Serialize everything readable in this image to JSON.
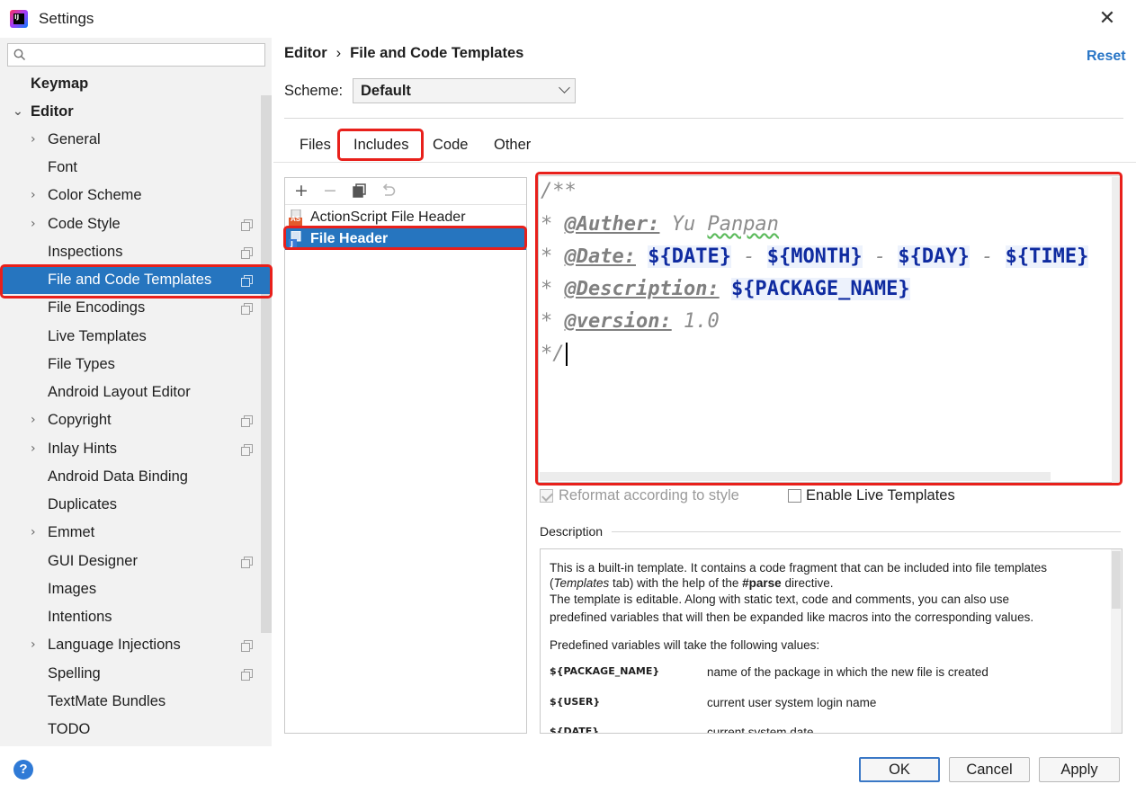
{
  "window": {
    "title": "Settings"
  },
  "sidebar": {
    "search_placeholder": "",
    "items": [
      {
        "label": "Keymap"
      },
      {
        "label": "Editor"
      },
      {
        "label": "General"
      },
      {
        "label": "Font"
      },
      {
        "label": "Color Scheme"
      },
      {
        "label": "Code Style"
      },
      {
        "label": "Inspections"
      },
      {
        "label": "File and Code Templates"
      },
      {
        "label": "File Encodings"
      },
      {
        "label": "Live Templates"
      },
      {
        "label": "File Types"
      },
      {
        "label": "Android Layout Editor"
      },
      {
        "label": "Copyright"
      },
      {
        "label": "Inlay Hints"
      },
      {
        "label": "Android Data Binding"
      },
      {
        "label": "Duplicates"
      },
      {
        "label": "Emmet"
      },
      {
        "label": "GUI Designer"
      },
      {
        "label": "Images"
      },
      {
        "label": "Intentions"
      },
      {
        "label": "Language Injections"
      },
      {
        "label": "Spelling"
      },
      {
        "label": "TextMate Bundles"
      },
      {
        "label": "TODO"
      }
    ]
  },
  "header": {
    "breadcrumb_parent": "Editor",
    "breadcrumb_sep": "›",
    "breadcrumb_current": "File and Code Templates",
    "reset_label": "Reset",
    "scheme_label": "Scheme:",
    "scheme_value": "Default"
  },
  "tabs": [
    {
      "label": "Files"
    },
    {
      "label": "Includes"
    },
    {
      "label": "Code"
    },
    {
      "label": "Other"
    }
  ],
  "templates": {
    "items": [
      {
        "name": "ActionScript File Header",
        "icon_text": "AS"
      },
      {
        "name": "File Header"
      }
    ],
    "selected": "File Header"
  },
  "editor": {
    "line1": "/**",
    "line2_star": "* ",
    "line2_tag": "@Auther:",
    "line2_value_a": " Yu ",
    "line2_value_b": "Panpan",
    "line3_star": "* ",
    "line3_tag": "@Date:",
    "line3_v1": "${DATE}",
    "line3_s1": " - ",
    "line3_v2": "${MONTH}",
    "line3_s2": " - ",
    "line3_v3": "${DAY}",
    "line3_s3": " - ",
    "line3_v4": "${TIME}",
    "line4_star": "* ",
    "line4_tag": "@Description:",
    "line4_v": "${PACKAGE_NAME}",
    "line5_star": "* ",
    "line5_tag": "@version:",
    "line5_value": " 1.0",
    "line6": "*/"
  },
  "options": {
    "reformat_label": "Reformat according to style",
    "reformat_checked": true,
    "live_templates_label": "Enable Live Templates",
    "live_templates_checked": false
  },
  "description": {
    "title": "Description",
    "p1_a": "This is a built-in template. It contains a code fragment that can be included into file templates",
    "p1_b_italic": "Templates",
    "p1_b_rest1": " tab) with the help of the ",
    "p1_b_bold": "#parse",
    "p1_b_rest2": " directive.",
    "p2_a": "The template is editable. Along with static text, code and comments, you can also use",
    "p2_b": "predefined variables that will then be expanded like macros into the corresponding values.",
    "p3": "Predefined variables will take the following values:",
    "vars": [
      {
        "name": "${PACKAGE_NAME}",
        "desc": "name of the package in which the new file is created"
      },
      {
        "name": "${USER}",
        "desc": "current user system login name"
      },
      {
        "name": "${DATE}",
        "desc": "current system date"
      }
    ]
  },
  "buttons": {
    "help": "?",
    "ok": "OK",
    "cancel": "Cancel",
    "apply": "Apply"
  }
}
